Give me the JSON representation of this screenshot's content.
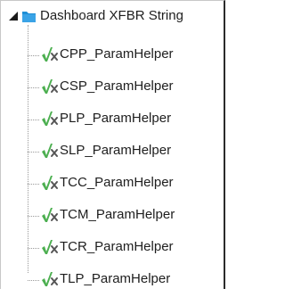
{
  "tree": {
    "root": {
      "label": "Dashboard XFBR String",
      "expander_icon": "expanded-triangle-icon",
      "icon": "folder-icon",
      "expanded": true
    },
    "children": [
      {
        "label": "CPP_ParamHelper",
        "icon": "function-icon"
      },
      {
        "label": "CSP_ParamHelper",
        "icon": "function-icon"
      },
      {
        "label": "PLP_ParamHelper",
        "icon": "function-icon"
      },
      {
        "label": "SLP_ParamHelper",
        "icon": "function-icon"
      },
      {
        "label": "TCC_ParamHelper",
        "icon": "function-icon"
      },
      {
        "label": "TCM_ParamHelper",
        "icon": "function-icon"
      },
      {
        "label": "TCR_ParamHelper",
        "icon": "function-icon"
      },
      {
        "label": "TLP_ParamHelper",
        "icon": "function-icon"
      }
    ]
  },
  "colors": {
    "folder": "#1f8fd6",
    "function_check": "#4caf50",
    "function_x": "#555555",
    "text": "#1e1e1e"
  }
}
